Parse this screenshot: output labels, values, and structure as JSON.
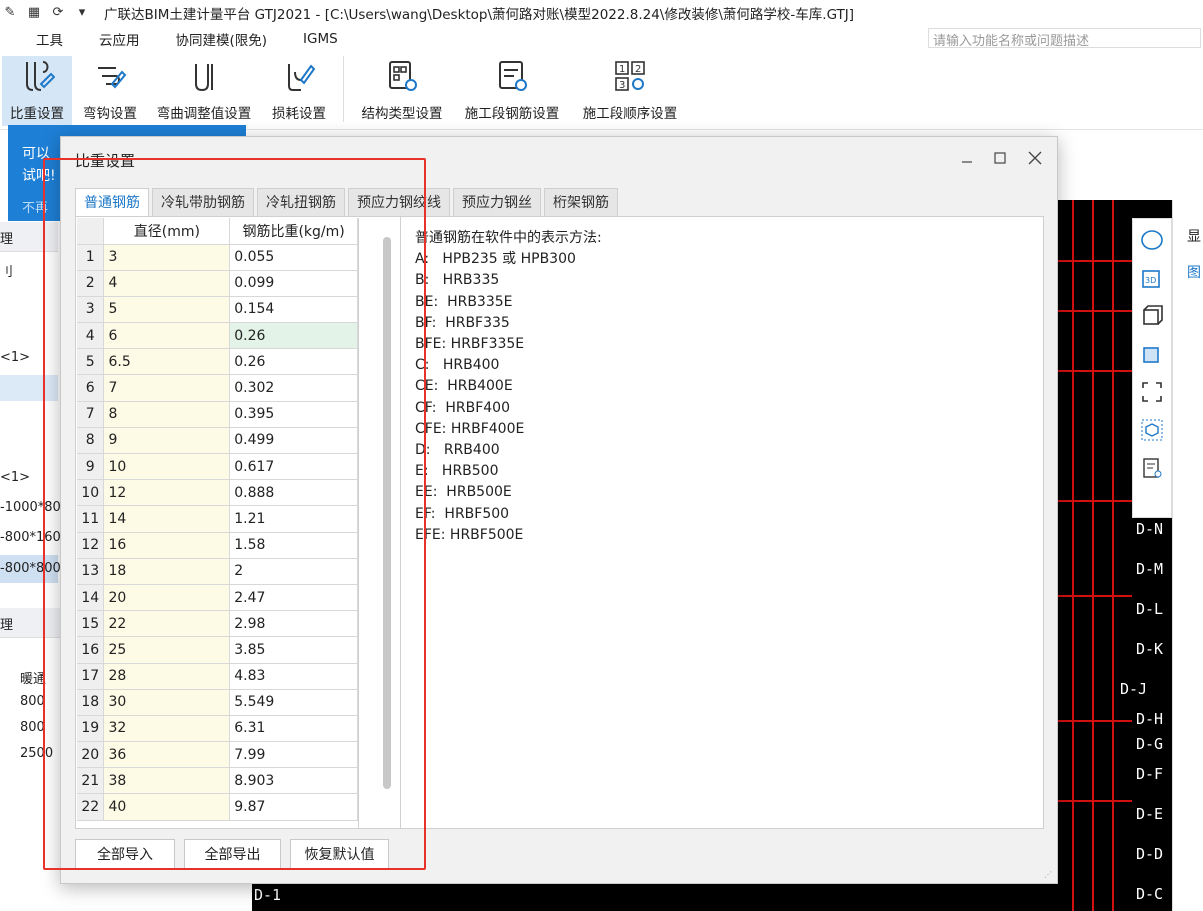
{
  "window": {
    "title": "广联达BIM土建计量平台 GTJ2021 - [C:\\Users\\wang\\Desktop\\萧何路对账\\模型2022.8.24\\修改装修\\萧何路学校-车库.GTJ]"
  },
  "menu": {
    "items": [
      "工具",
      "云应用",
      "协同建模(限免)",
      "IGMS"
    ],
    "search_placeholder": "请输入功能名称或问题描述"
  },
  "ribbon": {
    "buttons": [
      {
        "label": "比重设置",
        "icon": "weight-setting-icon"
      },
      {
        "label": "弯钩设置",
        "icon": "hook-setting-icon"
      },
      {
        "label": "弯曲调整值设置",
        "icon": "bend-adjust-icon"
      },
      {
        "label": "损耗设置",
        "icon": "loss-setting-icon"
      },
      {
        "label": "结构类型设置",
        "icon": "structure-type-icon"
      },
      {
        "label": "施工段钢筋设置",
        "icon": "segment-rebar-icon"
      },
      {
        "label": "施工段顺序设置",
        "icon": "segment-order-icon"
      }
    ]
  },
  "background": {
    "tooltip_line1": "可以",
    "tooltip_line2": "试吧!",
    "tooltip_line3": "不再",
    "left_texts": [
      "理",
      "刂",
      "<1>",
      "<1>",
      "-1000*80",
      "-800*160",
      "-800*800",
      "理",
      "暖通",
      "800",
      "800",
      "2500"
    ],
    "cad_labels": [
      "D-1",
      "D-N",
      "D-M",
      "D-L",
      "D-K",
      "D-J",
      "D-H",
      "D-G",
      "D-F",
      "D-E",
      "D-D",
      "D-C"
    ],
    "right_tab": "显",
    "right_subtab": "图"
  },
  "dialog": {
    "title": "比重设置",
    "tabs": [
      "普通钢筋",
      "冷轧带肋钢筋",
      "冷轧扭钢筋",
      "预应力钢绞线",
      "预应力钢丝",
      "桁架钢筋"
    ],
    "active_tab": 0,
    "table": {
      "headers": [
        "",
        "直径(mm)",
        "钢筋比重(kg/m)"
      ],
      "rows": [
        [
          "1",
          "3",
          "0.055"
        ],
        [
          "2",
          "4",
          "0.099"
        ],
        [
          "3",
          "5",
          "0.154"
        ],
        [
          "4",
          "6",
          "0.26"
        ],
        [
          "5",
          "6.5",
          "0.26"
        ],
        [
          "6",
          "7",
          "0.302"
        ],
        [
          "7",
          "8",
          "0.395"
        ],
        [
          "8",
          "9",
          "0.499"
        ],
        [
          "9",
          "10",
          "0.617"
        ],
        [
          "10",
          "12",
          "0.888"
        ],
        [
          "11",
          "14",
          "1.21"
        ],
        [
          "12",
          "16",
          "1.58"
        ],
        [
          "13",
          "18",
          "2"
        ],
        [
          "14",
          "20",
          "2.47"
        ],
        [
          "15",
          "22",
          "2.98"
        ],
        [
          "16",
          "25",
          "3.85"
        ],
        [
          "17",
          "28",
          "4.83"
        ],
        [
          "18",
          "30",
          "5.549"
        ],
        [
          "19",
          "32",
          "6.31"
        ],
        [
          "20",
          "36",
          "7.99"
        ],
        [
          "21",
          "38",
          "8.903"
        ],
        [
          "22",
          "40",
          "9.87"
        ]
      ],
      "selected_row": 3
    },
    "notes": [
      "普通钢筋在软件中的表示方法:",
      "A:   HPB235 或 HPB300",
      "B:   HRB335",
      "BE:  HRB335E",
      "BF:  HRBF335",
      "BFE: HRBF335E",
      "C:   HRB400",
      "CE:  HRB400E",
      "CF:  HRBF400",
      "CFE: HRBF400E",
      "D:   RRB400",
      "E:   HRB500",
      "EE:  HRB500E",
      "EF:  HRBF500",
      "EFE: HRBF500E"
    ],
    "buttons": {
      "import_all": "全部导入",
      "export_all": "全部导出",
      "restore_default": "恢复默认值"
    }
  },
  "colors": {
    "accent": "#1e78c8",
    "highlight_box": "#e8312b",
    "diameter_cell_bg": "#fdfbe6",
    "selected_cell_bg": "#e3f3e8",
    "cad_background": "#000000",
    "cad_lines": "#d21010"
  }
}
